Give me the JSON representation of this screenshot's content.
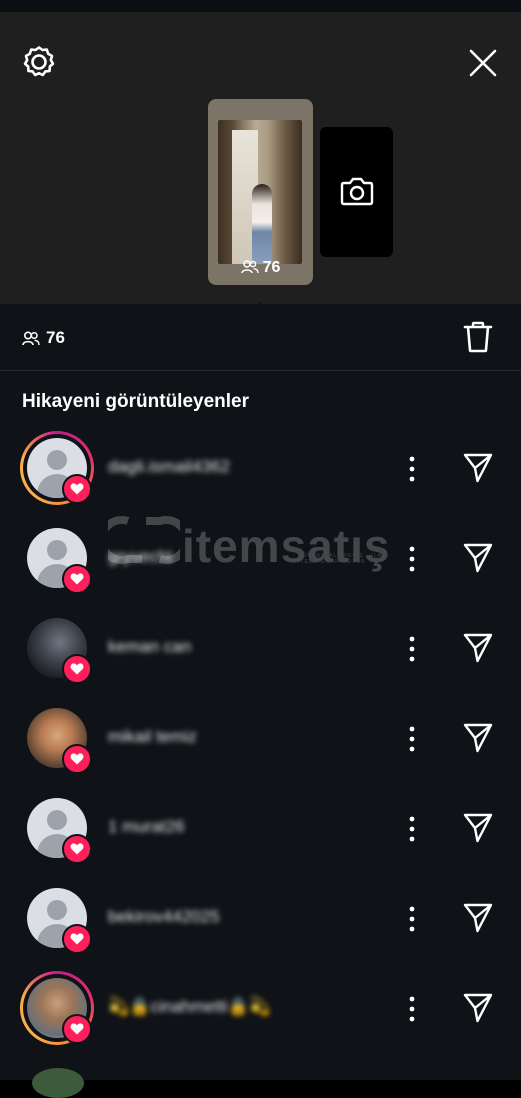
{
  "story": {
    "thumb_viewer_count": "76"
  },
  "viewers": {
    "count": "76",
    "section_title": "Hikayeni görüntüleyenler"
  },
  "rows": [
    {
      "username": "dagli.ismail4362"
    },
    {
      "username": "gryvecht"
    },
    {
      "username": "keman can"
    },
    {
      "username": "mikail temiz"
    },
    {
      "username": "1 murat26"
    },
    {
      "username": "bekirov442025"
    },
    {
      "username": "💫🔒cinahmetti🔒💫"
    }
  ],
  "watermark": {
    "brand": "itemsatış",
    "tagline": "GÜVENLİ ALIŞVERİŞ · İLAN · İTEM · E-PİN · OYUN"
  },
  "colors": {
    "panel": "#0f1217",
    "header": "#1f1f1f",
    "heart": "#ff1f5a"
  },
  "icons": [
    "settings-icon",
    "close-icon",
    "camera-icon",
    "viewers-icon",
    "trash-icon",
    "more-icon",
    "send-icon",
    "heart-icon"
  ]
}
